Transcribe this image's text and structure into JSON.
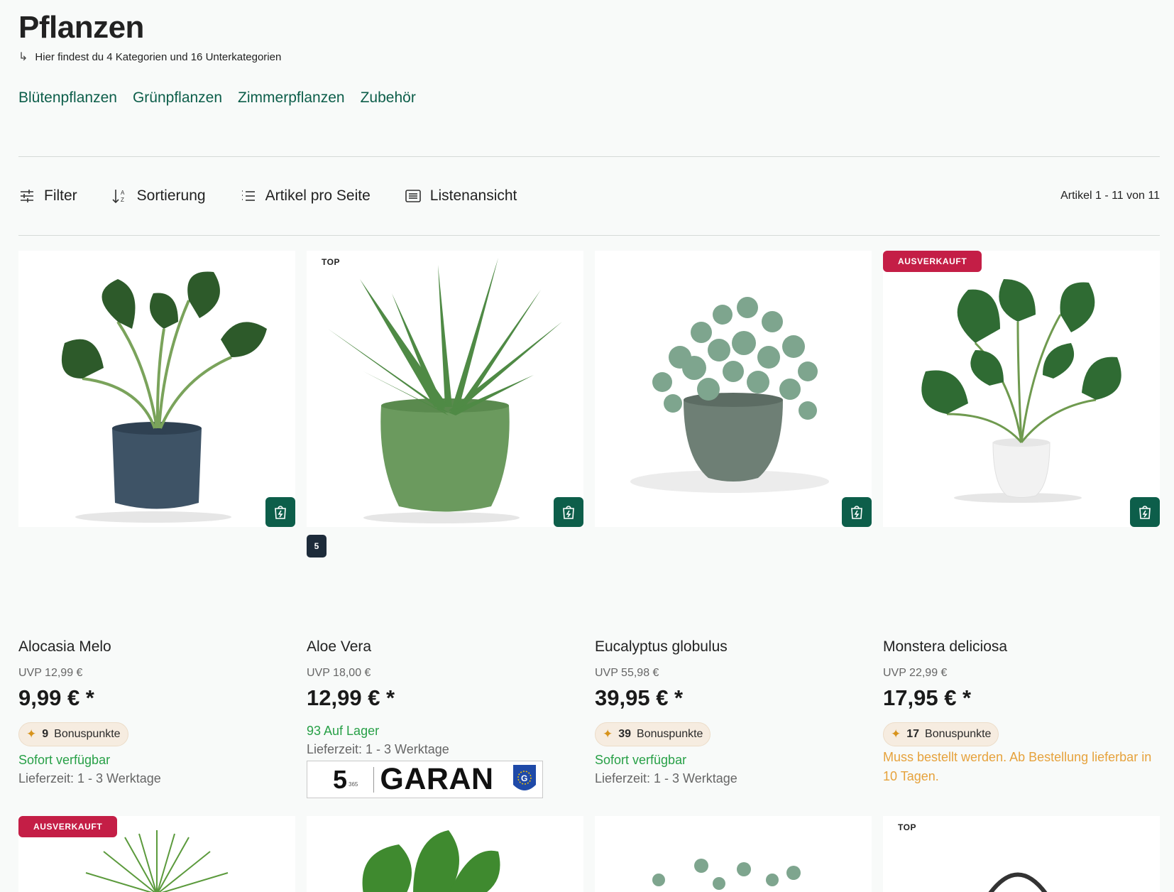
{
  "header": {
    "title": "Pflanzen",
    "subtitle": "Hier findest du 4 Kategorien und 16 Unterkategorien"
  },
  "categories": [
    "Blütenpflanzen",
    "Grünpflanzen",
    "Zimmerpflanzen",
    "Zubehör"
  ],
  "toolbar": {
    "filter": "Filter",
    "sort": "Sortierung",
    "per_page": "Artikel pro Seite",
    "view": "Listenansicht",
    "count": "Artikel 1 - 11 von 11"
  },
  "products": [
    {
      "name": "Alocasia Melo",
      "uvp": "UVP 12,99 €",
      "price": "9,99 € *",
      "bonus_points": "9",
      "bonus_label": "Bonuspunkte",
      "availability": "Sofort verfügbar",
      "delivery": "Lieferzeit: 1 - 3 Werktage"
    },
    {
      "name": "Aloe Vera",
      "badge": "TOP",
      "bubble": "5",
      "uvp": "UVP 18,00 €",
      "price": "12,99 € *",
      "availability": "93 Auf Lager",
      "delivery": "Lieferzeit: 1 - 3 Werktage",
      "guarantee_num": "5",
      "guarantee_small": "365",
      "guarantee_word": "GARAN"
    },
    {
      "name": "Eucalyptus globulus",
      "uvp": "UVP 55,98 €",
      "price": "39,95 € *",
      "bonus_points": "39",
      "bonus_label": "Bonuspunkte",
      "availability": "Sofort verfügbar",
      "delivery": "Lieferzeit: 1 - 3 Werktage"
    },
    {
      "name": "Monstera deliciosa",
      "badge": "AUSVERKAUFT",
      "uvp": "UVP 22,99 €",
      "price": "17,95 € *",
      "bonus_points": "17",
      "bonus_label": "Bonuspunkte",
      "availability": "Muss bestellt werden. Ab Bestellung lieferbar in 10 Tagen."
    }
  ],
  "row2": [
    {
      "badge": "AUSVERKAUFT"
    },
    {},
    {},
    {
      "badge": "TOP"
    }
  ],
  "colors": {
    "accent": "#0d5e4a",
    "sold": "#c41e46",
    "available": "#28a047",
    "order": "#e6a23c"
  }
}
